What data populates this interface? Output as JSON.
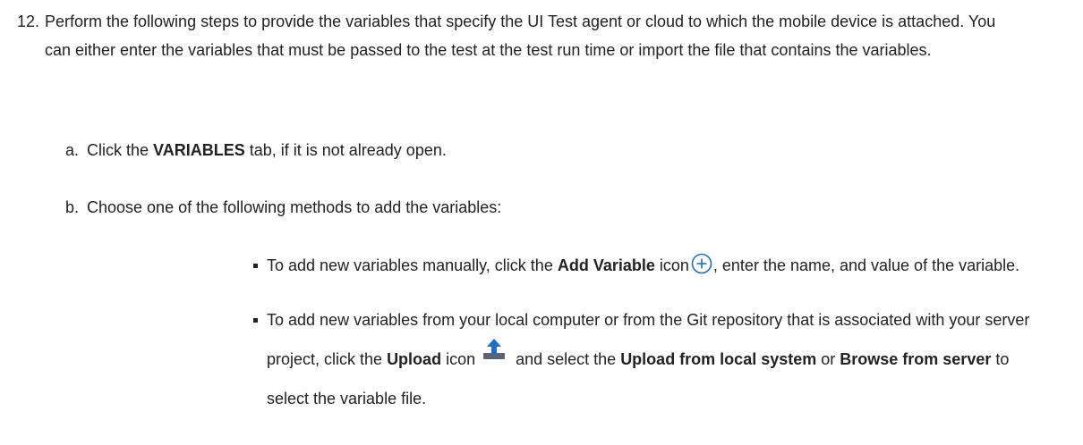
{
  "step": {
    "number": "12.",
    "text": "Perform the following steps to provide the variables that specify the UI Test agent or cloud to which the mobile device is attached. You can either enter the variables that must be passed to the test at the test run time or import the file that contains the variables."
  },
  "sub_a": {
    "label": "a.",
    "pre": "Click the ",
    "bold": "VARIABLES",
    "post": " tab, if it is not already open."
  },
  "sub_b": {
    "label": "b.",
    "text": "Choose one of the following methods to add the variables:"
  },
  "bullet_1": {
    "pre": "To add new variables manually, click the ",
    "bold": "Add Variable",
    "mid": " icon",
    "icon": "add-circle-icon",
    "post": ", enter the name, and value of the variable."
  },
  "bullet_2": {
    "pre": "To add new variables from your local computer or from the Git repository that is associated with your server project, click the ",
    "bold1": "Upload",
    "mid1": " icon",
    "icon": "upload-icon",
    "mid2": " and select the ",
    "bold2": "Upload from local system",
    "mid3": " or ",
    "bold3": "Browse from server",
    "post": " to select the variable file."
  },
  "colors": {
    "text": "#222222",
    "icon_blue": "#1f6fc5",
    "upload_gray": "#5a6470"
  }
}
